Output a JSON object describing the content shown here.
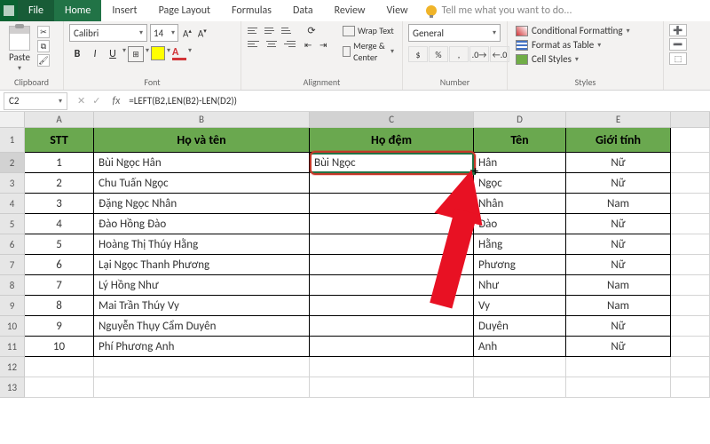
{
  "titlebar": {
    "tabs": [
      "File",
      "Home",
      "Insert",
      "Page Layout",
      "Formulas",
      "Data",
      "Review",
      "View"
    ],
    "active": 1,
    "tell": "Tell me what you want to do..."
  },
  "ribbon": {
    "clipboard": {
      "paste": "Paste",
      "label": "Clipboard"
    },
    "font": {
      "name": "Calibri",
      "size": "14",
      "label": "Font"
    },
    "alignment": {
      "wrap": "Wrap Text",
      "merge": "Merge & Center",
      "label": "Alignment"
    },
    "number": {
      "format": "General",
      "label": "Number"
    },
    "styles": {
      "cond": "Conditional Formatting",
      "table": "Format as Table",
      "cell": "Cell Styles",
      "label": "Styles"
    }
  },
  "namebox": "C2",
  "formula": "=LEFT(B2,LEN(B2)-LEN(D2))",
  "columns": [
    "A",
    "B",
    "C",
    "D",
    "E"
  ],
  "headers": {
    "A": "STT",
    "B": "Họ và tên",
    "C": "Họ đệm",
    "D": "Tên",
    "E": "Giới tính"
  },
  "rows": [
    {
      "n": "1",
      "A": "1",
      "B": "Bùi Ngọc Hân",
      "C": "Bùi Ngọc",
      "D": "Hân",
      "E": "Nữ"
    },
    {
      "n": "2",
      "A": "2",
      "B": "Chu Tuấn Ngọc",
      "C": "",
      "D": "Ngọc",
      "E": "Nữ"
    },
    {
      "n": "3",
      "A": "3",
      "B": "Đặng Ngọc Nhân",
      "C": "",
      "D": "Nhân",
      "E": "Nam"
    },
    {
      "n": "4",
      "A": "4",
      "B": "Đào Hồng Đào",
      "C": "",
      "D": "Đào",
      "E": "Nữ"
    },
    {
      "n": "5",
      "A": "5",
      "B": "Hoàng Thị Thúy Hằng",
      "C": "",
      "D": "Hằng",
      "E": "Nữ"
    },
    {
      "n": "6",
      "A": "6",
      "B": "Lại Ngọc Thanh Phương",
      "C": "",
      "D": "Phương",
      "E": "Nữ"
    },
    {
      "n": "7",
      "A": "7",
      "B": "Lý Hồng Như",
      "C": "",
      "D": "Như",
      "E": "Nam"
    },
    {
      "n": "8",
      "A": "8",
      "B": "Mai Trần Thúy Vy",
      "C": "",
      "D": "Vy",
      "E": "Nam"
    },
    {
      "n": "9",
      "A": "9",
      "B": "Nguyễn Thụy Cẩm Duyên",
      "C": "",
      "D": "Duyên",
      "E": "Nữ"
    },
    {
      "n": "10",
      "A": "10",
      "B": "Phí Phương Anh",
      "C": "",
      "D": "Anh",
      "E": "Nữ"
    }
  ]
}
